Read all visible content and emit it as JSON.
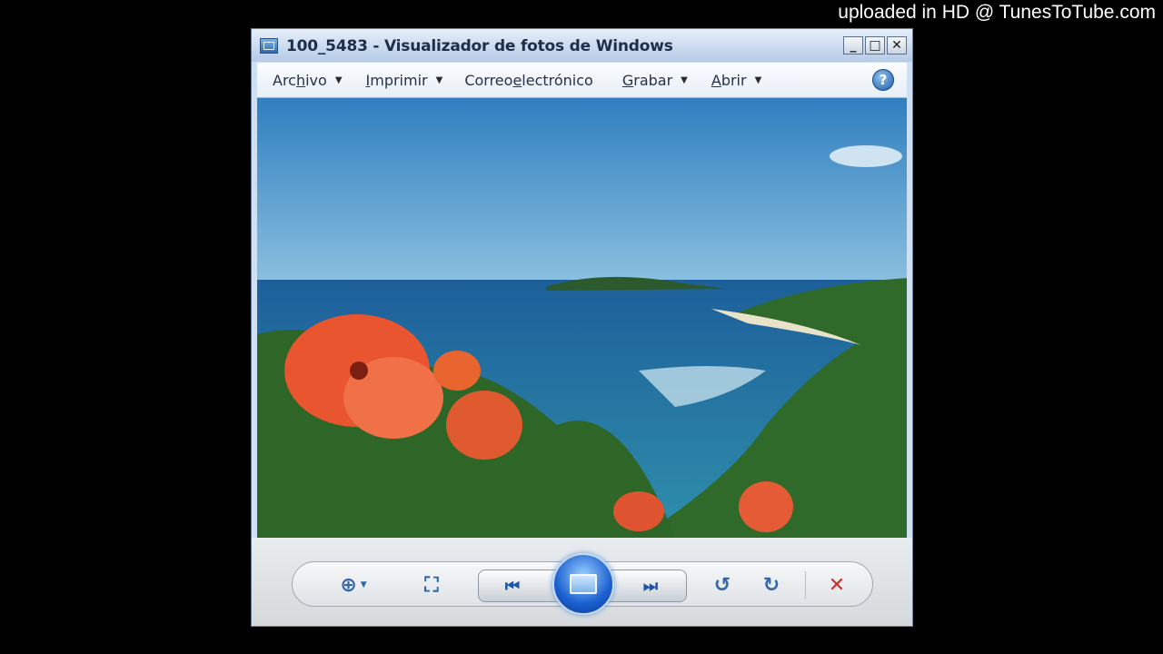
{
  "watermark": "uploaded in HD @ TunesToTube.com",
  "window": {
    "title": "100_5483 - Visualizador de fotos de Windows"
  },
  "menu": {
    "items": [
      {
        "pre": "Arc",
        "u": "h",
        "post": "ivo",
        "has_caret": true
      },
      {
        "pre": "",
        "u": "I",
        "post": "mprimir",
        "has_caret": true
      },
      {
        "pre": "Correo ",
        "u": "e",
        "post": "lectrónico",
        "has_caret": false
      },
      {
        "pre": "",
        "u": "G",
        "post": "rabar",
        "has_caret": true
      },
      {
        "pre": "",
        "u": "A",
        "post": "brir",
        "has_caret": true
      }
    ],
    "help_label": "?"
  },
  "photo": {
    "subject": "tropical coastline with red hibiscus flowers",
    "colors": {
      "sky": "#3d8cc8",
      "sea": "#1e6fa3",
      "foliage": "#2f6a2a",
      "flower": "#e8552f"
    }
  },
  "controls": {
    "zoom_icon": "zoom-icon",
    "fit_icon": "actual-size-icon",
    "prev_icon": "previous-icon",
    "slideshow_icon": "slideshow-icon",
    "next_icon": "next-icon",
    "rotate_ccw_icon": "rotate-counterclockwise-icon",
    "rotate_cw_icon": "rotate-clockwise-icon",
    "delete_icon": "delete-icon",
    "accent": "#3166a8",
    "delete_color": "#c8322b"
  }
}
